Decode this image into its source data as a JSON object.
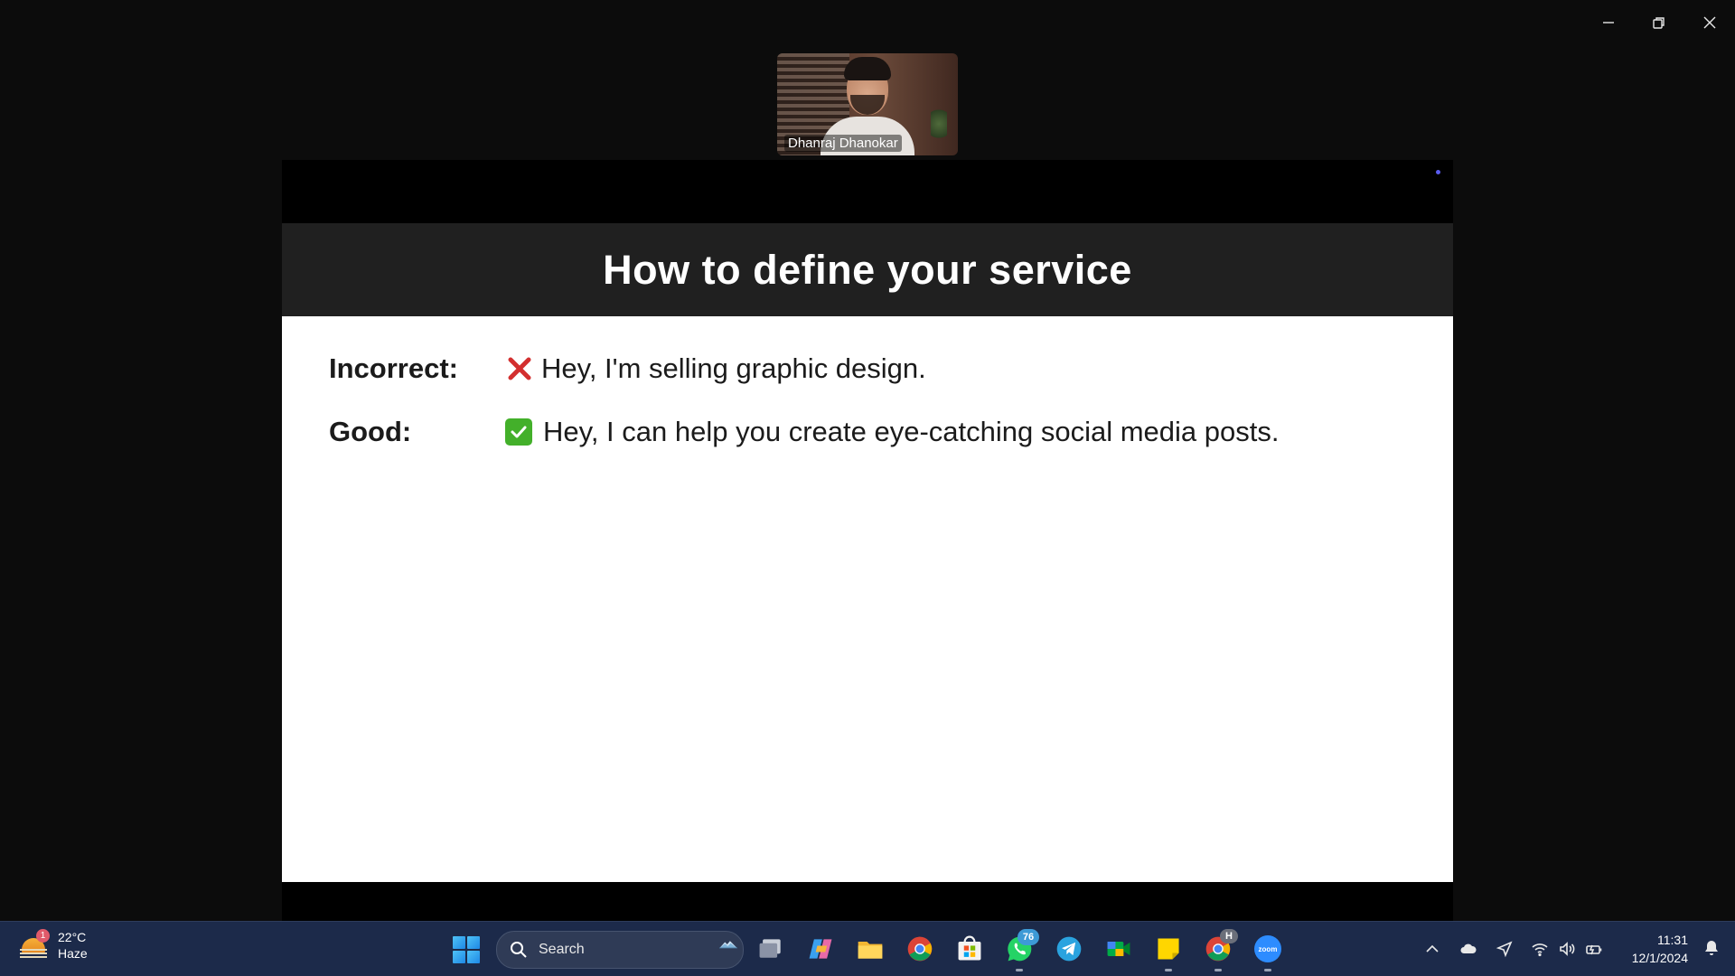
{
  "participant": {
    "name": "Dhanraj Dhanokar"
  },
  "slide": {
    "title": "How to define your service",
    "rows": [
      {
        "label": "Incorrect:",
        "mark": "cross-mark-icon",
        "text": "Hey, I'm selling graphic design."
      },
      {
        "label": "Good:",
        "mark": "check-mark-icon",
        "text": "Hey, I can help you create eye-catching social media posts."
      }
    ]
  },
  "taskbar": {
    "weather": {
      "temp": "22°C",
      "condition": "Haze",
      "badge": "1"
    },
    "search_label": "Search",
    "whatsapp_badge": "76",
    "zoom_label": "zoom",
    "chrome_profile_letter": "H",
    "clock": {
      "time": "11:31",
      "date": "12/1/2024"
    }
  },
  "colors": {
    "taskbar": "#1c2a4a",
    "slide_header": "#202020",
    "cross": "#d32f2f",
    "check": "#43b02a"
  }
}
